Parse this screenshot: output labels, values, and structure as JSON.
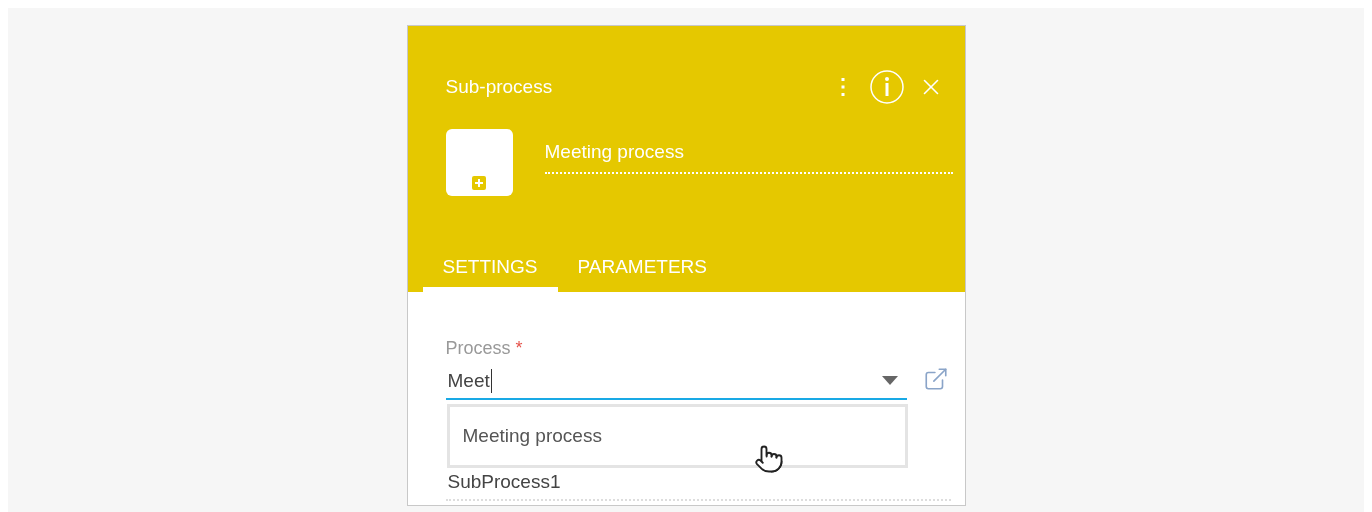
{
  "panel": {
    "title": "Sub-process",
    "name": "Meeting process"
  },
  "tabs": [
    {
      "label": "SETTINGS",
      "selected": true
    },
    {
      "label": "PARAMETERS",
      "selected": false
    }
  ],
  "process_field": {
    "label": "Process",
    "required_mark": "*",
    "value": "Meet"
  },
  "dropdown": {
    "options": [
      {
        "label": "Meeting process"
      }
    ]
  },
  "next_field": {
    "value": "SubProcess1"
  }
}
